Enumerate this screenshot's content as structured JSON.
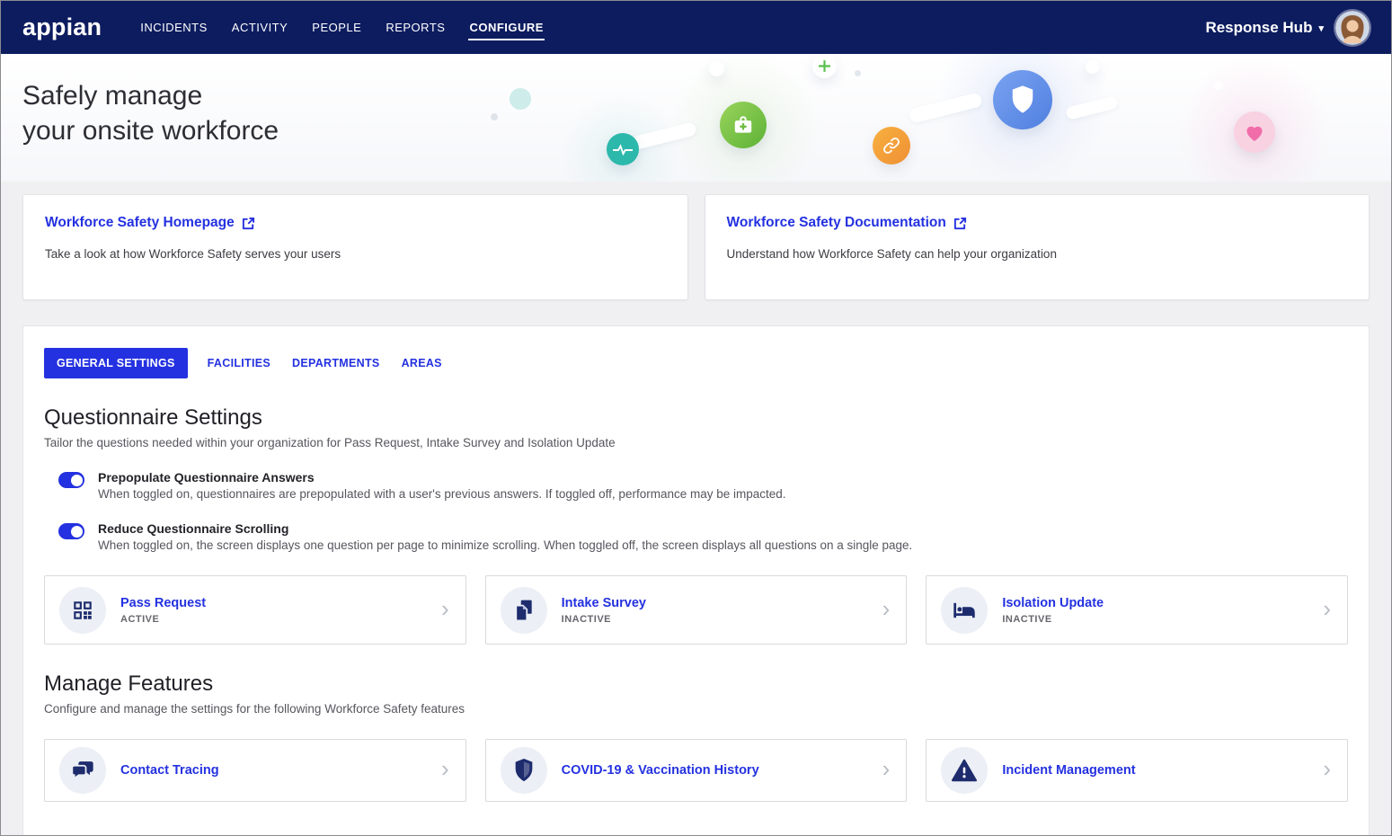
{
  "colors": {
    "navbar_bg": "#0d1c5f",
    "accent_blue": "#2431e0",
    "page_bg": "#f0f0f2",
    "icon_navy": "#1e2c6e",
    "status_text": "#66666e"
  },
  "icons": {
    "chevron_right": "›",
    "caret_down": "▾"
  },
  "navbar": {
    "logo": "appian",
    "items": [
      {
        "label": "INCIDENTS"
      },
      {
        "label": "ACTIVITY"
      },
      {
        "label": "PEOPLE"
      },
      {
        "label": "REPORTS"
      },
      {
        "label": "CONFIGURE"
      }
    ],
    "workspace_label": "Response Hub"
  },
  "hero": {
    "title_line1": "Safely manage",
    "title_line2": "your onsite workforce"
  },
  "info_cards": [
    {
      "title": "Workforce Safety Homepage",
      "description": "Take a look at how Workforce Safety serves your users"
    },
    {
      "title": "Workforce Safety Documentation",
      "description": "Understand how Workforce Safety can help your organization"
    }
  ],
  "tabs": [
    {
      "label": "GENERAL SETTINGS"
    },
    {
      "label": "FACILITIES"
    },
    {
      "label": "DEPARTMENTS"
    },
    {
      "label": "AREAS"
    }
  ],
  "questionnaire": {
    "title": "Questionnaire Settings",
    "subtitle": "Tailor the questions needed within your organization for Pass Request, Intake Survey and Isolation Update",
    "toggles": [
      {
        "label": "Prepopulate Questionnaire Answers",
        "description": "When toggled on, questionnaires are prepopulated with a user's previous answers. If toggled off, performance may be impacted.",
        "state": "on"
      },
      {
        "label": "Reduce Questionnaire Scrolling",
        "description": "When toggled on, the screen displays one question per page to minimize scrolling. When toggled off, the screen displays all questions on a single page.",
        "state": "on"
      }
    ],
    "cards": [
      {
        "title": "Pass Request",
        "status": "ACTIVE",
        "icon": "qr-code-icon"
      },
      {
        "title": "Intake Survey",
        "status": "INACTIVE",
        "icon": "copy-document-icon"
      },
      {
        "title": "Isolation Update",
        "status": "INACTIVE",
        "icon": "bed-icon"
      }
    ]
  },
  "features": {
    "title": "Manage Features",
    "subtitle": "Configure and manage the settings for the following Workforce Safety features",
    "cards": [
      {
        "title": "Contact Tracing",
        "icon": "chat-bubbles-icon"
      },
      {
        "title": "COVID-19 & Vaccination History",
        "icon": "shield-icon"
      },
      {
        "title": "Incident Management",
        "icon": "warning-icon"
      }
    ]
  }
}
